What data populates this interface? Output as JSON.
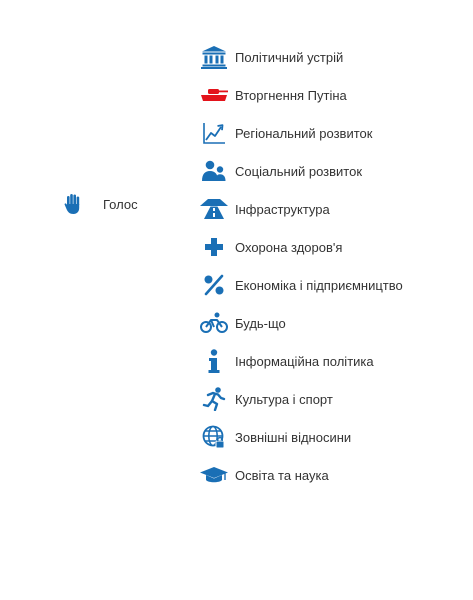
{
  "colors": {
    "icon_blue": "#1a6fb5",
    "icon_red": "#e3131b",
    "text": "#333333"
  },
  "left_nav": {
    "label": "Голос",
    "icon": "raised-hand-icon"
  },
  "categories": [
    {
      "label": "Політичний устрій",
      "icon": "government-building-icon"
    },
    {
      "label": "Вторгнення Путіна",
      "icon": "tank-icon"
    },
    {
      "label": "Регіональний розвиток",
      "icon": "trend-chart-icon"
    },
    {
      "label": "Соціальний розвиток",
      "icon": "people-icon"
    },
    {
      "label": "Інфраструктура",
      "icon": "road-icon"
    },
    {
      "label": "Охорона здоров'я",
      "icon": "medical-cross-icon"
    },
    {
      "label": "Економіка і підприємництво",
      "icon": "percent-icon"
    },
    {
      "label": "Будь-що",
      "icon": "bicycle-icon"
    },
    {
      "label": "Інформаційна політика",
      "icon": "info-icon"
    },
    {
      "label": "Культура і спорт",
      "icon": "runner-icon"
    },
    {
      "label": "Зовнішні відносини",
      "icon": "globe-lock-icon"
    },
    {
      "label": "Освіта та наука",
      "icon": "graduation-cap-icon"
    }
  ]
}
